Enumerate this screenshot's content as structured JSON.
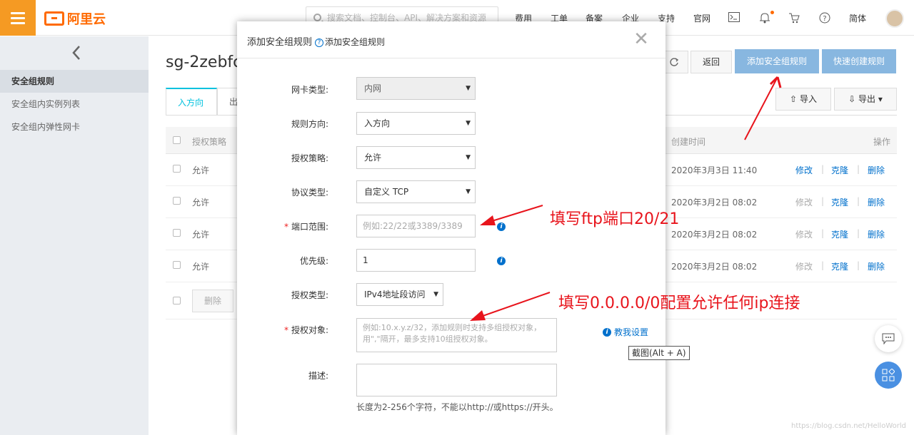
{
  "header": {
    "logo_text": "阿里云",
    "search_placeholder": "搜索文档、控制台、API、解决方案和资源",
    "nav": [
      "费用",
      "工单",
      "备案",
      "企业",
      "支持",
      "官网"
    ],
    "lang": "简体"
  },
  "sidebar": {
    "items": [
      {
        "label": "安全组规则",
        "active": true
      },
      {
        "label": "安全组内实例列表",
        "active": false
      },
      {
        "label": "安全组内弹性网卡",
        "active": false
      }
    ]
  },
  "main": {
    "title": "sg-2zebfc",
    "buttons": {
      "back": "返回",
      "add_rule": "添加安全组规则",
      "quick_create": "快速创建规则",
      "import": "导入",
      "export": "导出"
    },
    "tabs": [
      "入方向",
      "出"
    ],
    "table": {
      "columns": {
        "policy": "授权策略",
        "created": "创建时间",
        "ops": "操作"
      },
      "rows": [
        {
          "policy": "允许",
          "created": "2020年3月3日 11:40",
          "edit": "修改",
          "clone": "克隆",
          "delete": "删除"
        },
        {
          "policy": "允许",
          "created": "2020年3月2日 08:02",
          "edit": "修改",
          "clone": "克隆",
          "delete": "删除"
        },
        {
          "policy": "允许",
          "created": "2020年3月2日 08:02",
          "edit": "修改",
          "clone": "克隆",
          "delete": "删除"
        },
        {
          "policy": "允许",
          "created": "2020年3月2日 08:02",
          "edit": "修改",
          "clone": "克隆",
          "delete": "删除"
        }
      ],
      "footer_delete": "删除"
    }
  },
  "modal": {
    "title": "添加安全组规则",
    "help_link": "添加安全组规则",
    "fields": {
      "nic_type": {
        "label": "网卡类型:",
        "value": "内网"
      },
      "direction": {
        "label": "规则方向:",
        "value": "入方向"
      },
      "policy": {
        "label": "授权策略:",
        "value": "允许"
      },
      "protocol": {
        "label": "协议类型:",
        "value": "自定义 TCP"
      },
      "port_range": {
        "label": "端口范围:",
        "placeholder": "例如:22/22或3389/3389"
      },
      "priority": {
        "label": "优先级:",
        "value": "1"
      },
      "auth_type": {
        "label": "授权类型:",
        "value": "IPv4地址段访问"
      },
      "auth_object": {
        "label": "授权对象:",
        "placeholder": "例如:10.x.y.z/32，添加规则时支持多组授权对象，用\",\"隔开，最多支持10组授权对象。"
      },
      "description": {
        "label": "描述:",
        "hint": "长度为2-256个字符，不能以http://或https://开头。"
      }
    },
    "teach_me": "教我设置"
  },
  "annotations": {
    "port_note": "填写ftp端口20/21",
    "ip_note": "填写0.0.0.0/0配置允许任何ip连接",
    "tooltip": "截图(Alt + A)"
  },
  "watermark": "https://blog.csdn.net/HelloWorld",
  "colors": {
    "brand": "#ff6a00",
    "primary_button": "#88b7e0",
    "link": "#0070cc",
    "annotation": "#e8141c"
  }
}
